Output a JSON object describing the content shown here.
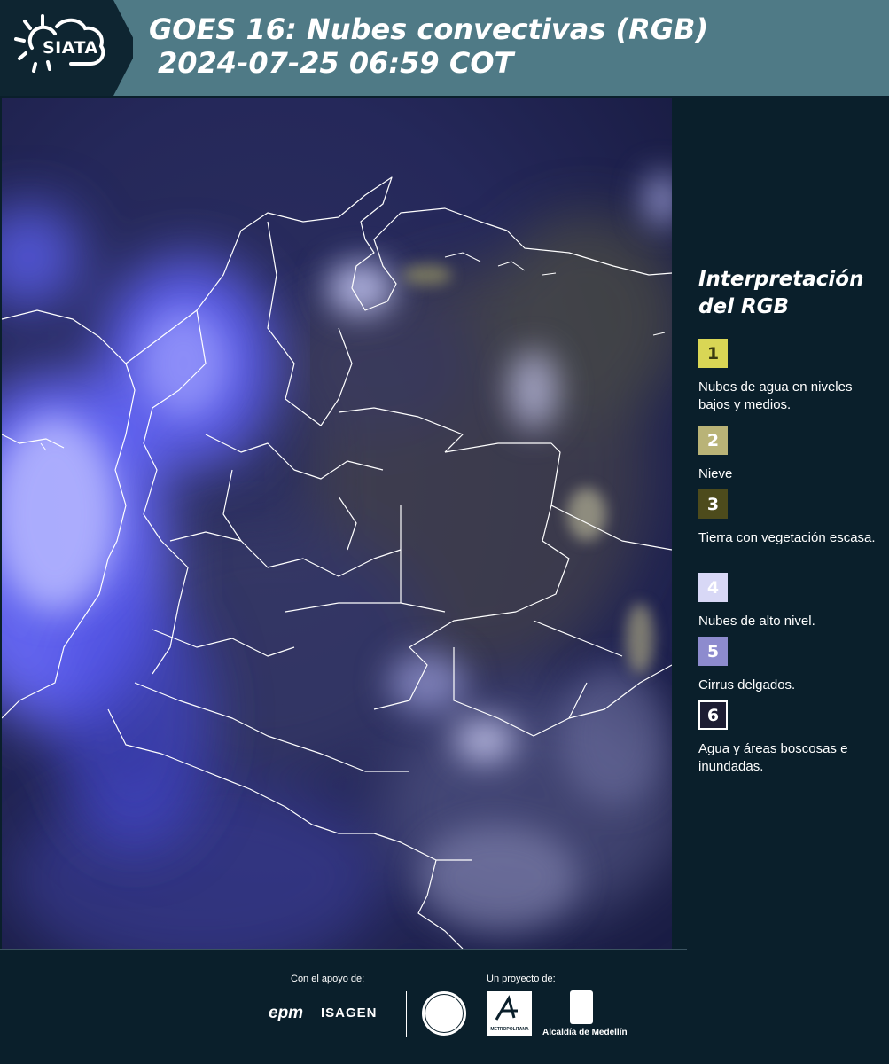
{
  "header": {
    "brand": "SIATA",
    "title_line1": "GOES 16: Nubes convectivas (RGB)",
    "title_line2": "2024-07-25 06:59 COT",
    "background_color": "#4f7a86",
    "logo_bg_color": "#0e2531"
  },
  "map": {
    "icon": "satellite-map-image",
    "background_color": "#1b1f4a",
    "cloud_color": "#5a5cff",
    "border_color": "#ffffff"
  },
  "legend": {
    "title": "Interpretación del RGB",
    "items": [
      {
        "number": "1",
        "label": "Nubes de agua en niveles bajos y medios.",
        "color": "#d9d655",
        "text_color": "#3a3a10",
        "border_color": "#d9d655"
      },
      {
        "number": "2",
        "label": "Nieve",
        "color": "#b9b377",
        "text_color": "#ffffff",
        "border_color": "#b9b377"
      },
      {
        "number": "3",
        "label": "Tierra con vegetación escasa.",
        "color": "#4d4b1c",
        "text_color": "#ffffff",
        "border_color": "#4d4b1c"
      },
      {
        "number": "4",
        "label": "Nubes de alto nivel.",
        "color": "#d8d8f6",
        "text_color": "#ffffff",
        "border_color": "#d8d8f6"
      },
      {
        "number": "5",
        "label": "Cirrus delgados.",
        "color": "#8d8bce",
        "text_color": "#ffffff",
        "border_color": "#8d8bce"
      },
      {
        "number": "6",
        "label": "Agua y áreas boscosas e inundadas.",
        "color": "#1d1d33",
        "text_color": "#ffffff",
        "border_color": "#ffffff"
      }
    ]
  },
  "footer": {
    "support_caption": "Con el apoyo de:",
    "project_caption": "Un proyecto de:",
    "sponsors": [
      "epm",
      "ISAGEN"
    ],
    "area_logo_text": "METROPOLITANA",
    "alcaldia_text": "Alcaldía de Medellín"
  }
}
